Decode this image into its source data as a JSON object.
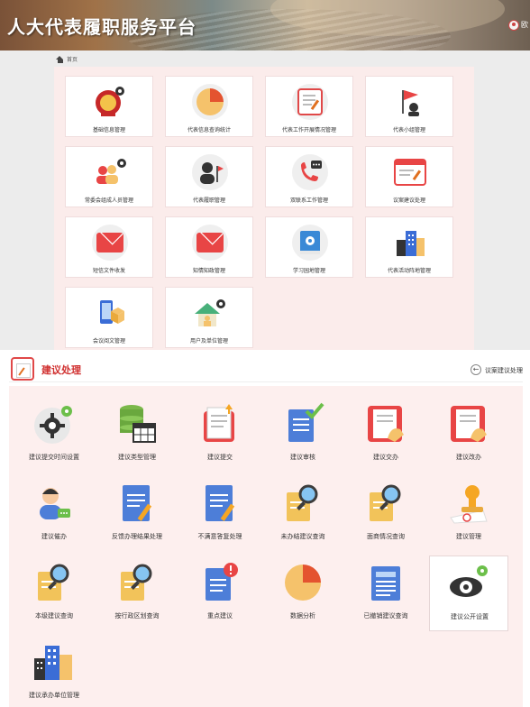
{
  "app": {
    "title": "人大代表履职服务平台",
    "user_name": "欧"
  },
  "breadcrumb": {
    "home": "首页"
  },
  "top_modules": [
    {
      "label": "基础信息管理",
      "icon": "emblem-gear-icon"
    },
    {
      "label": "代表信息查询统计",
      "icon": "pie-chart-icon"
    },
    {
      "label": "代表工作开展情况管理",
      "icon": "document-edit-icon"
    },
    {
      "label": "代表小组管理",
      "icon": "group-flag-icon"
    },
    {
      "label": "常委会组成人员管理",
      "icon": "people-gear-icon"
    },
    {
      "label": "代表履职管理",
      "icon": "person-flag-icon"
    },
    {
      "label": "双联系工作管理",
      "icon": "phone-chat-icon"
    },
    {
      "label": "议案建议处理",
      "icon": "browser-edit-icon"
    },
    {
      "label": "短信文件收发",
      "icon": "mail-icon"
    },
    {
      "label": "知情知政管理",
      "icon": "mail-icon"
    },
    {
      "label": "学习园地管理",
      "icon": "book-icon"
    },
    {
      "label": "代表活动阵地管理",
      "icon": "buildings-icon"
    },
    {
      "label": "会议阅文管理",
      "icon": "phone-box-icon"
    },
    {
      "label": "用户及单位管理",
      "icon": "house-gear-icon"
    }
  ],
  "section": {
    "title": "建议处理",
    "back_label": "议案建议处理"
  },
  "suggestion_items": [
    {
      "label": "建议提交时间设置",
      "icon": "gear-icon"
    },
    {
      "label": "建议类型管理",
      "icon": "database-table-icon"
    },
    {
      "label": "建议提交",
      "icon": "document-upload-icon"
    },
    {
      "label": "建议审核",
      "icon": "document-check-icon"
    },
    {
      "label": "建议交办",
      "icon": "hand-document-icon"
    },
    {
      "label": "建议改办",
      "icon": "hand-document-icon"
    },
    {
      "label": "建议催办",
      "icon": "person-chat-icon"
    },
    {
      "label": "反馈办理结果处理",
      "icon": "document-pen-icon"
    },
    {
      "label": "不满意答复处理",
      "icon": "document-pen-icon"
    },
    {
      "label": "未办结建议查询",
      "icon": "document-search-icon"
    },
    {
      "label": "面商情况查询",
      "icon": "document-search-icon"
    },
    {
      "label": "建议管理",
      "icon": "stamp-icon"
    },
    {
      "label": "本级建议查询",
      "icon": "document-search-icon"
    },
    {
      "label": "按行政区划查询",
      "icon": "document-search-icon"
    },
    {
      "label": "重点建议",
      "icon": "document-alert-icon"
    },
    {
      "label": "数据分析",
      "icon": "pie-chart-icon"
    },
    {
      "label": "已撤销建议查询",
      "icon": "newspaper-icon"
    },
    {
      "label": "建议公开设置",
      "icon": "eye-gear-icon"
    },
    {
      "label": "建议承办单位管理",
      "icon": "buildings-icon"
    }
  ],
  "colors": {
    "accent": "#d0302f",
    "panel_bg": "#fdefee",
    "tile_bg": "#ffffff"
  }
}
